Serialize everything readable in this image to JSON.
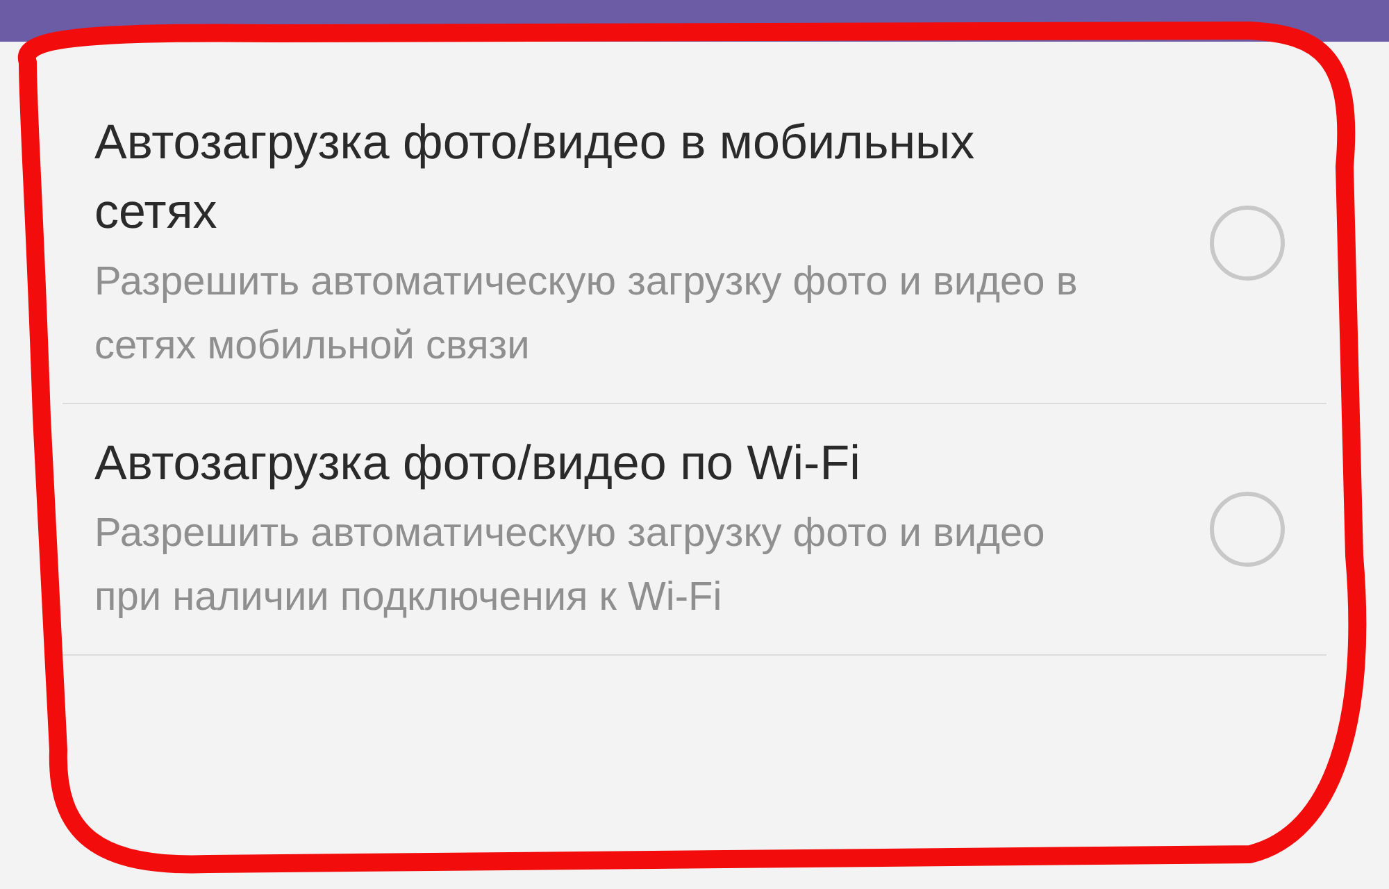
{
  "settings": [
    {
      "title": "Автозагрузка фото/видео в мобильных сетях",
      "description": "Разрешить автоматическую загрузку фото и видео в сетях мобильной связи",
      "checked": false
    },
    {
      "title": "Автозагрузка фото/видео по Wi-Fi",
      "description": "Разрешить автоматическую загрузку фото и видео при наличии подключения к Wi-Fi",
      "checked": false
    }
  ]
}
